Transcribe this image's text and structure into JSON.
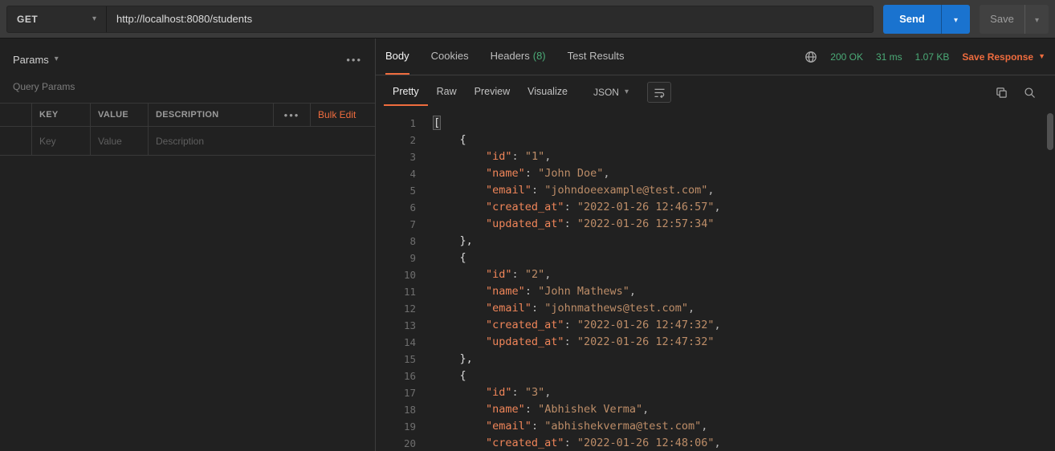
{
  "request_bar": {
    "method": "GET",
    "url": "http://localhost:8080/students",
    "send_label": "Send",
    "save_label": "Save"
  },
  "params_panel": {
    "title": "Params",
    "section_label": "Query Params",
    "col_key": "KEY",
    "col_value": "VALUE",
    "col_description": "DESCRIPTION",
    "bulk_edit_label": "Bulk Edit",
    "placeholder_key": "Key",
    "placeholder_value": "Value",
    "placeholder_description": "Description"
  },
  "response_panel": {
    "tab_body": "Body",
    "tab_cookies": "Cookies",
    "tab_headers": "Headers",
    "headers_count": "(8)",
    "tab_test_results": "Test Results",
    "status_code": "200 OK",
    "response_time": "31 ms",
    "response_size": "1.07 KB",
    "save_response_label": "Save Response",
    "view_pretty": "Pretty",
    "view_raw": "Raw",
    "view_preview": "Preview",
    "view_visualize": "Visualize",
    "format_selector": "JSON"
  },
  "code": {
    "language": "json",
    "lines": [
      [
        [
          "bh",
          "["
        ]
      ],
      [
        [
          "p",
          "    "
        ],
        [
          "b",
          "{"
        ]
      ],
      [
        [
          "p",
          "        "
        ],
        [
          "k",
          "\"id\""
        ],
        [
          "p",
          ": "
        ],
        [
          "s",
          "\"1\""
        ],
        [
          "p",
          ","
        ]
      ],
      [
        [
          "p",
          "        "
        ],
        [
          "k",
          "\"name\""
        ],
        [
          "p",
          ": "
        ],
        [
          "s",
          "\"John Doe\""
        ],
        [
          "p",
          ","
        ]
      ],
      [
        [
          "p",
          "        "
        ],
        [
          "k",
          "\"email\""
        ],
        [
          "p",
          ": "
        ],
        [
          "s",
          "\"johndoeexample@test.com\""
        ],
        [
          "p",
          ","
        ]
      ],
      [
        [
          "p",
          "        "
        ],
        [
          "k",
          "\"created_at\""
        ],
        [
          "p",
          ": "
        ],
        [
          "s",
          "\"2022-01-26 12:46:57\""
        ],
        [
          "p",
          ","
        ]
      ],
      [
        [
          "p",
          "        "
        ],
        [
          "k",
          "\"updated_at\""
        ],
        [
          "p",
          ": "
        ],
        [
          "s",
          "\"2022-01-26 12:57:34\""
        ]
      ],
      [
        [
          "p",
          "    "
        ],
        [
          "b",
          "},"
        ]
      ],
      [
        [
          "p",
          "    "
        ],
        [
          "b",
          "{"
        ]
      ],
      [
        [
          "p",
          "        "
        ],
        [
          "k",
          "\"id\""
        ],
        [
          "p",
          ": "
        ],
        [
          "s",
          "\"2\""
        ],
        [
          "p",
          ","
        ]
      ],
      [
        [
          "p",
          "        "
        ],
        [
          "k",
          "\"name\""
        ],
        [
          "p",
          ": "
        ],
        [
          "s",
          "\"John Mathews\""
        ],
        [
          "p",
          ","
        ]
      ],
      [
        [
          "p",
          "        "
        ],
        [
          "k",
          "\"email\""
        ],
        [
          "p",
          ": "
        ],
        [
          "s",
          "\"johnmathews@test.com\""
        ],
        [
          "p",
          ","
        ]
      ],
      [
        [
          "p",
          "        "
        ],
        [
          "k",
          "\"created_at\""
        ],
        [
          "p",
          ": "
        ],
        [
          "s",
          "\"2022-01-26 12:47:32\""
        ],
        [
          "p",
          ","
        ]
      ],
      [
        [
          "p",
          "        "
        ],
        [
          "k",
          "\"updated_at\""
        ],
        [
          "p",
          ": "
        ],
        [
          "s",
          "\"2022-01-26 12:47:32\""
        ]
      ],
      [
        [
          "p",
          "    "
        ],
        [
          "b",
          "},"
        ]
      ],
      [
        [
          "p",
          "    "
        ],
        [
          "b",
          "{"
        ]
      ],
      [
        [
          "p",
          "        "
        ],
        [
          "k",
          "\"id\""
        ],
        [
          "p",
          ": "
        ],
        [
          "s",
          "\"3\""
        ],
        [
          "p",
          ","
        ]
      ],
      [
        [
          "p",
          "        "
        ],
        [
          "k",
          "\"name\""
        ],
        [
          "p",
          ": "
        ],
        [
          "s",
          "\"Abhishek Verma\""
        ],
        [
          "p",
          ","
        ]
      ],
      [
        [
          "p",
          "        "
        ],
        [
          "k",
          "\"email\""
        ],
        [
          "p",
          ": "
        ],
        [
          "s",
          "\"abhishekverma@test.com\""
        ],
        [
          "p",
          ","
        ]
      ],
      [
        [
          "p",
          "        "
        ],
        [
          "k",
          "\"created_at\""
        ],
        [
          "p",
          ": "
        ],
        [
          "s",
          "\"2022-01-26 12:48:06\""
        ],
        [
          "p",
          ","
        ]
      ]
    ]
  },
  "colors": {
    "accent_orange": "#ef6c3e",
    "status_green": "#4bab77",
    "send_blue": "#1a73cf",
    "json_key": "#ef8559",
    "json_string": "#bd8d68"
  }
}
